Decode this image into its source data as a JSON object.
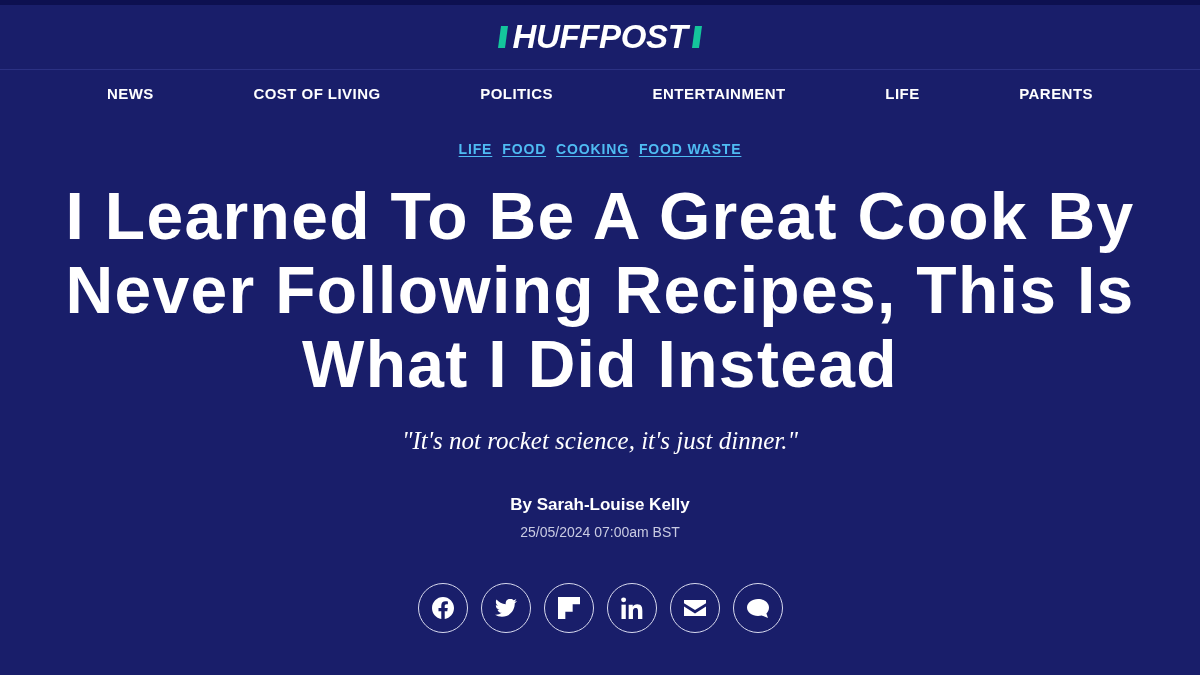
{
  "header": {
    "logo": "HUFFPOST"
  },
  "nav": [
    "NEWS",
    "COST OF LIVING",
    "POLITICS",
    "ENTERTAINMENT",
    "LIFE",
    "PARENTS"
  ],
  "tags": [
    "LIFE",
    "FOOD",
    "COOKING",
    "FOOD WASTE"
  ],
  "article": {
    "headline": "I Learned To Be A Great Cook By Never Following Recipes, This Is What I Did Instead",
    "subheadline": "\"It's not rocket science, it's just dinner.\"",
    "byline": "By Sarah-Louise Kelly",
    "timestamp": "25/05/2024 07:00am BST"
  },
  "share_buttons": [
    {
      "kind": "facebook"
    },
    {
      "kind": "twitter"
    },
    {
      "kind": "flipboard"
    },
    {
      "kind": "linkedin"
    },
    {
      "kind": "email"
    },
    {
      "kind": "comments"
    }
  ]
}
